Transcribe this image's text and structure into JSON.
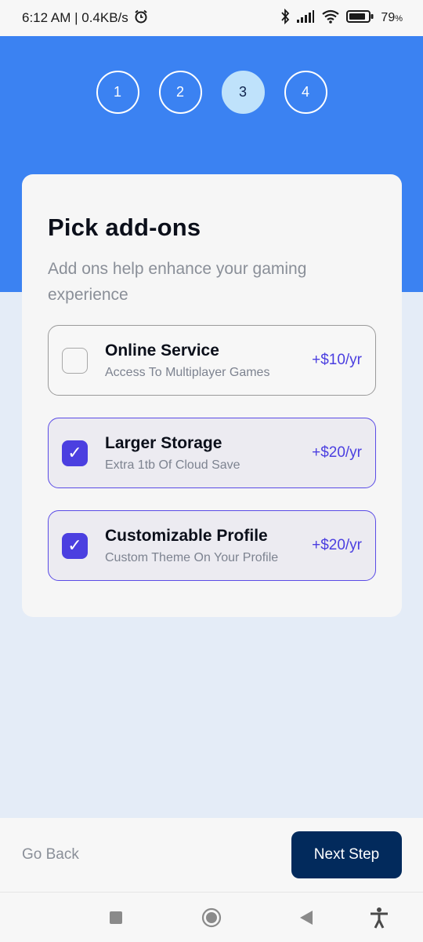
{
  "status_bar": {
    "time_speed": "6:12 AM | 0.4KB/s",
    "battery": "79"
  },
  "steps": [
    "1",
    "2",
    "3",
    "4"
  ],
  "active_step": 3,
  "card": {
    "title": "Pick add-ons",
    "subtitle": "Add ons help enhance your gaming experience"
  },
  "addons": [
    {
      "name": "Online Service",
      "description": "Access To Multiplayer Games",
      "price": "+$10/yr",
      "checked": false,
      "check_glyph": ""
    },
    {
      "name": "Larger Storage",
      "description": "Extra 1tb Of Cloud Save",
      "price": "+$20/yr",
      "checked": true,
      "check_glyph": "✓"
    },
    {
      "name": "Customizable Profile",
      "description": "Custom Theme On Your Profile",
      "price": "+$20/yr",
      "checked": true,
      "check_glyph": "✓"
    }
  ],
  "footer": {
    "back_label": "Go Back",
    "next_label": "Next Step"
  },
  "colors": {
    "hero": "#3b82f2",
    "accent": "#4b3fe0",
    "next_button": "#022a5c",
    "active_step": "#bfe2fb"
  },
  "icons": [
    "alarm-icon",
    "bluetooth-icon",
    "signal-icon",
    "wifi-icon",
    "battery-icon",
    "recents-icon",
    "home-icon",
    "back-icon",
    "accessibility-icon"
  ]
}
